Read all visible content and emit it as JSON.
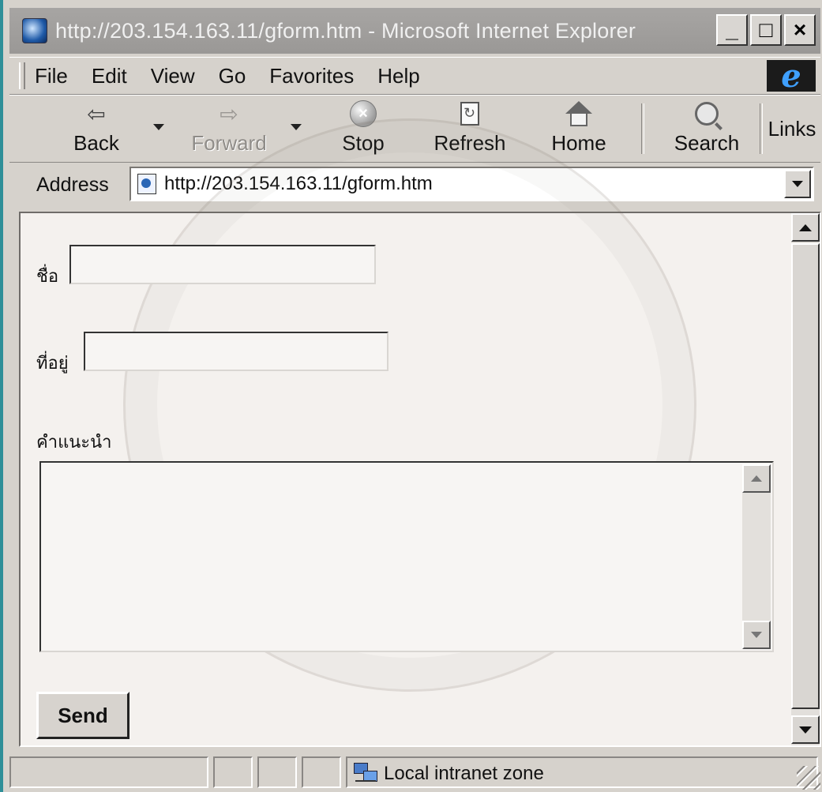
{
  "window": {
    "title": "http://203.154.163.11/gform.htm - Microsoft Internet Explorer",
    "controls": [
      "_",
      "□",
      "×"
    ]
  },
  "menu": {
    "items": [
      "File",
      "Edit",
      "View",
      "Go",
      "Favorites",
      "Help"
    ]
  },
  "toolbar": {
    "back": "Back",
    "forward": "Forward",
    "stop": "Stop",
    "refresh": "Refresh",
    "home": "Home",
    "search": "Search",
    "links": "Links"
  },
  "address": {
    "label": "Address",
    "url": "http://203.154.163.11/gform.htm"
  },
  "form": {
    "name_label": "ชื่อ",
    "address_label": "ที่อยู่",
    "suggestion_label": "คำแนะนำ",
    "send_button": "Send"
  },
  "status": {
    "zone": "Local intranet zone"
  }
}
